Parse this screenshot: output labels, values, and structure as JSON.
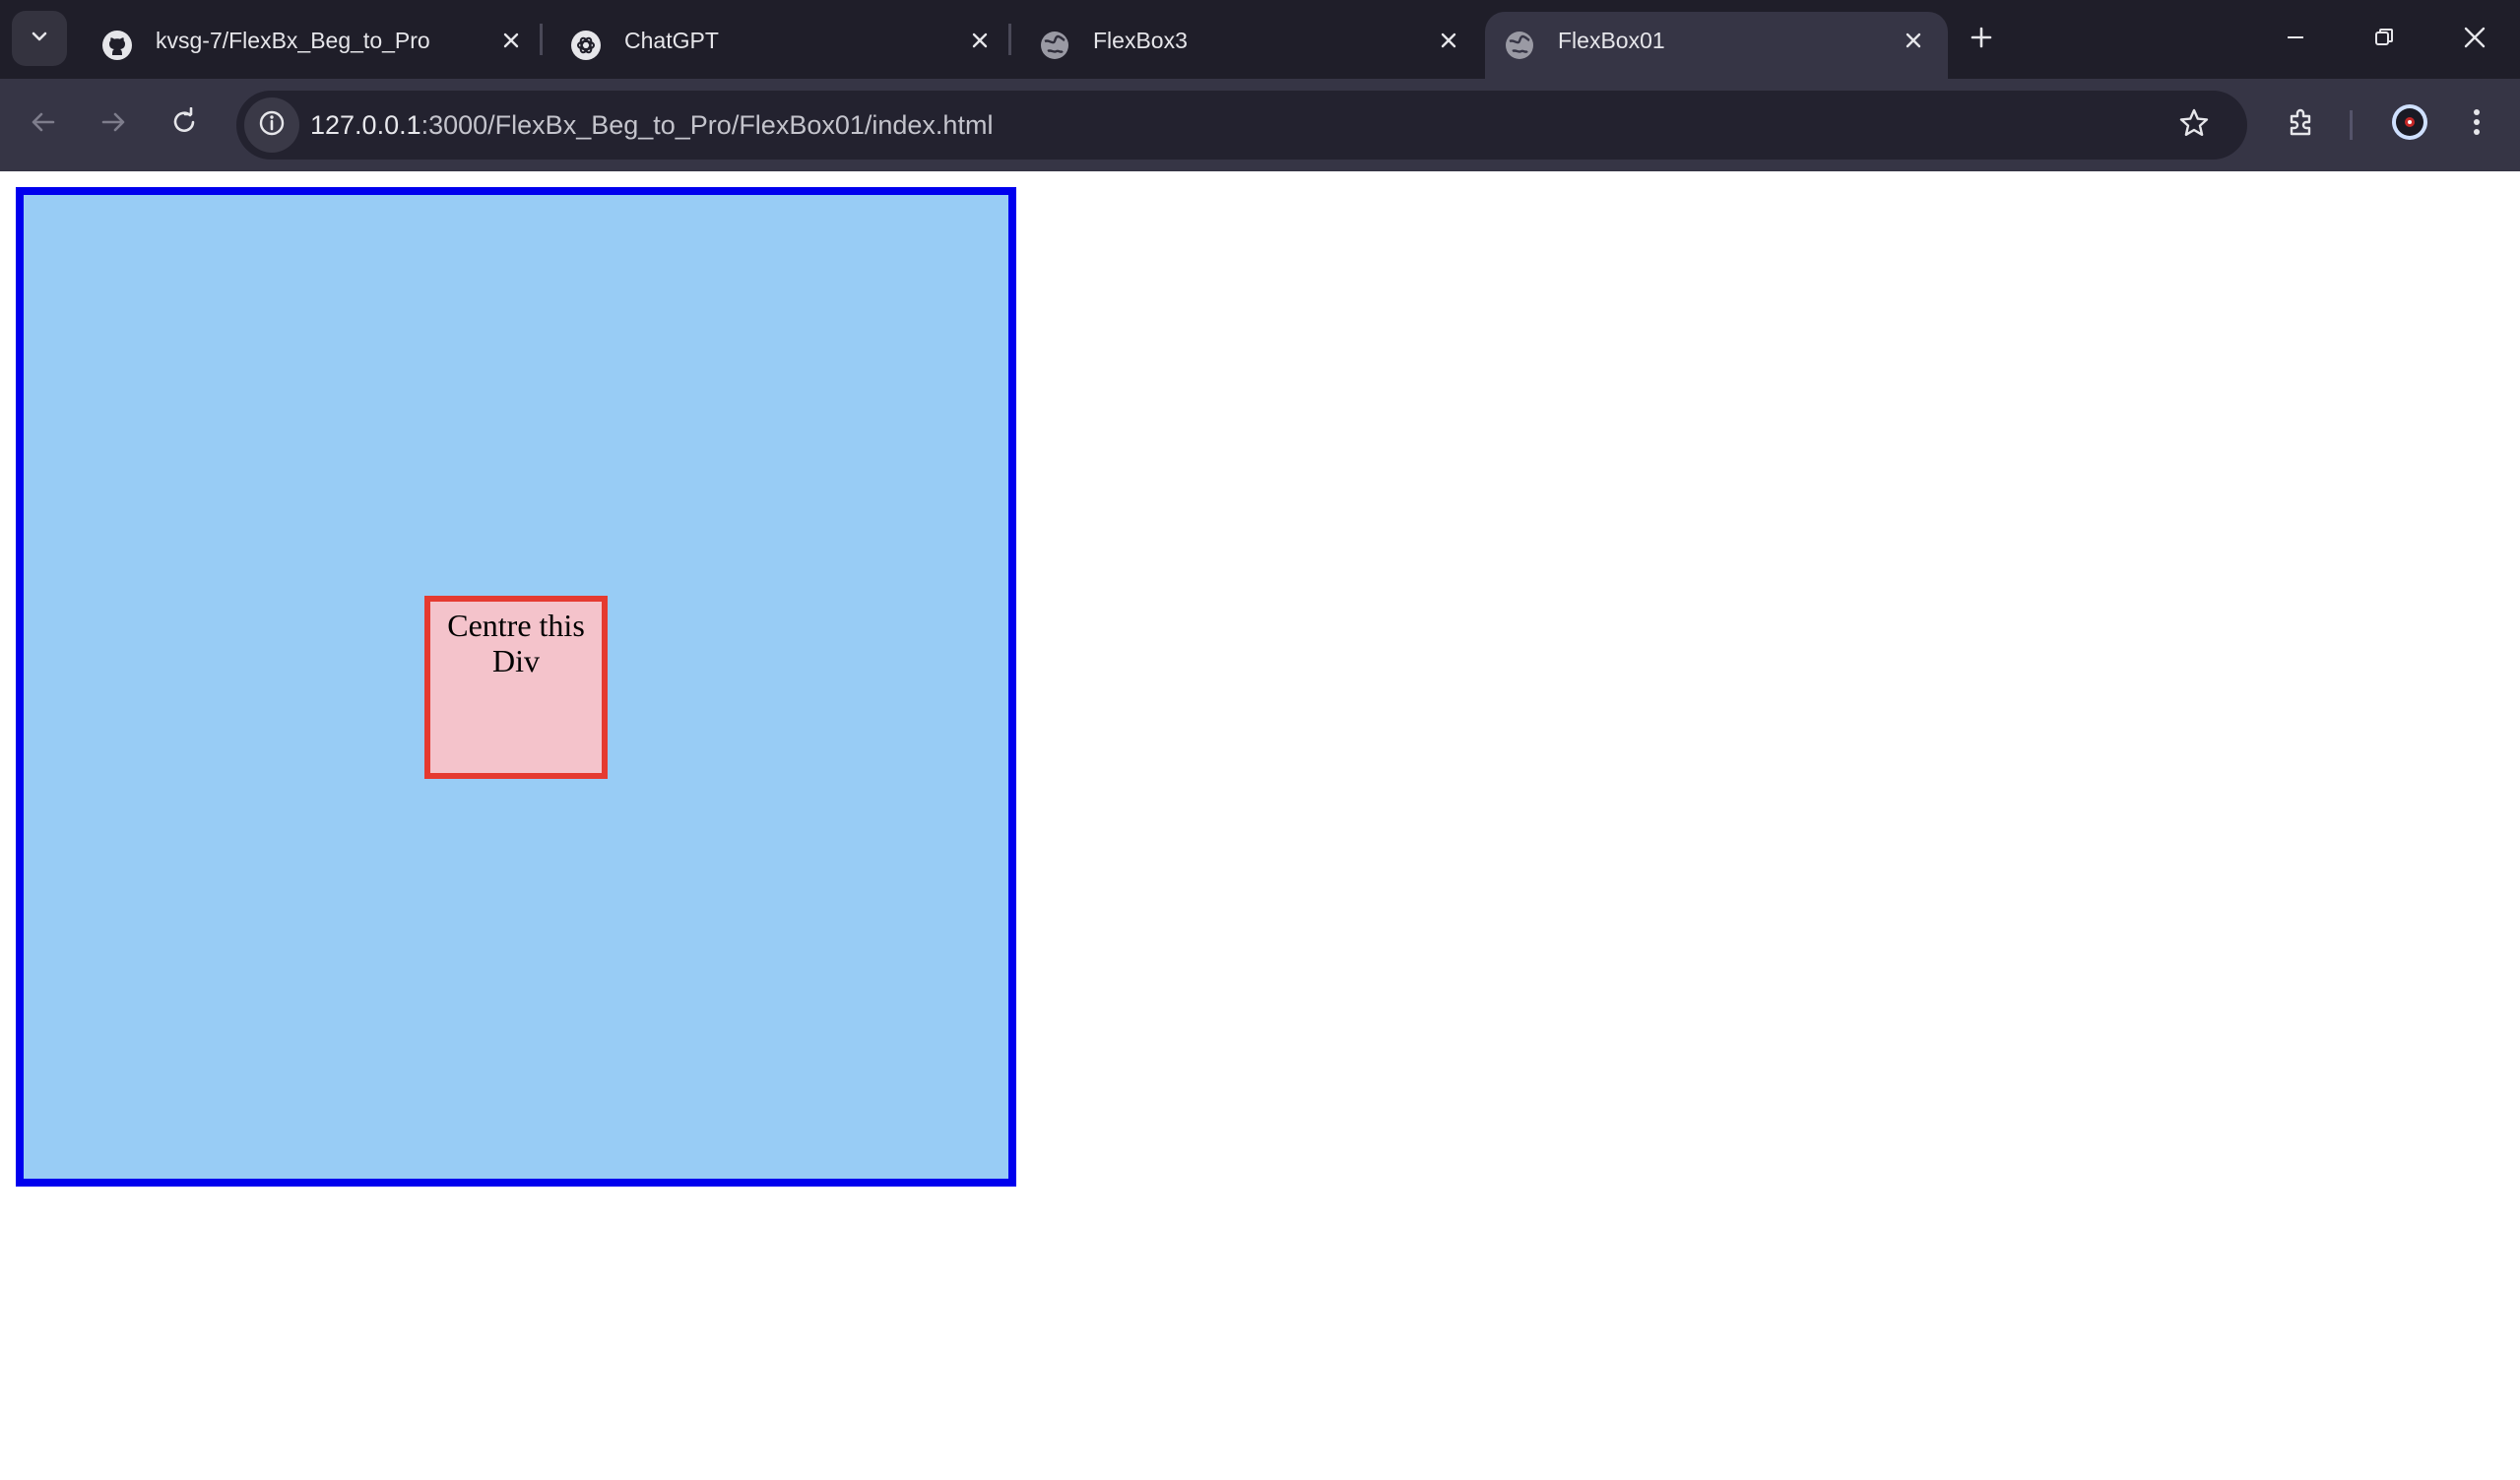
{
  "browser": {
    "tabs": [
      {
        "title": "kvsg-7/FlexBx_Beg_to_Pro",
        "icon": "github-icon",
        "active": false
      },
      {
        "title": "ChatGPT",
        "icon": "chatgpt-icon",
        "active": false
      },
      {
        "title": "FlexBox3",
        "icon": "globe-icon",
        "active": false
      },
      {
        "title": "FlexBox01",
        "icon": "globe-icon",
        "active": true
      }
    ],
    "address": {
      "host": "127.0.0.1",
      "rest": ":3000/FlexBx_Beg_to_Pro/FlexBox01/index.html"
    }
  },
  "page": {
    "box_text": "Centre this Div"
  },
  "colors": {
    "container_border": "#0000ee",
    "container_bg": "#98ccf5",
    "box_border": "#e53a30",
    "box_bg": "#f4c3cb"
  }
}
